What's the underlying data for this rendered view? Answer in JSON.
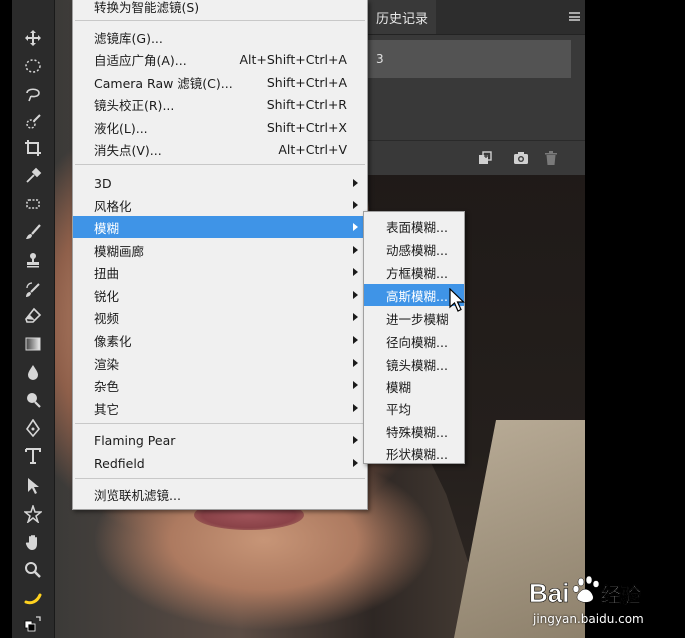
{
  "menu": {
    "items": [
      {
        "label": "转换为智能滤镜(S)",
        "shortcut": ""
      },
      {
        "label": "滤镜库(G)...",
        "shortcut": ""
      },
      {
        "label": "自适应广角(A)...",
        "shortcut": "Alt+Shift+Ctrl+A"
      },
      {
        "label": "Camera Raw 滤镜(C)...",
        "shortcut": "Shift+Ctrl+A"
      },
      {
        "label": "镜头校正(R)...",
        "shortcut": "Shift+Ctrl+R"
      },
      {
        "label": "液化(L)...",
        "shortcut": "Shift+Ctrl+X"
      },
      {
        "label": "消失点(V)...",
        "shortcut": "Alt+Ctrl+V"
      },
      {
        "label": "3D",
        "submenu": true
      },
      {
        "label": "风格化",
        "submenu": true
      },
      {
        "label": "模糊",
        "submenu": true,
        "highlighted": true
      },
      {
        "label": "模糊画廊",
        "submenu": true
      },
      {
        "label": "扭曲",
        "submenu": true
      },
      {
        "label": "锐化",
        "submenu": true
      },
      {
        "label": "视频",
        "submenu": true
      },
      {
        "label": "像素化",
        "submenu": true
      },
      {
        "label": "渲染",
        "submenu": true
      },
      {
        "label": "杂色",
        "submenu": true
      },
      {
        "label": "其它",
        "submenu": true
      },
      {
        "label": "Flaming Pear",
        "submenu": true
      },
      {
        "label": "Redfield",
        "submenu": true
      },
      {
        "label": "浏览联机滤镜...",
        "shortcut": ""
      }
    ]
  },
  "submenu": {
    "items": [
      {
        "label": "表面模糊..."
      },
      {
        "label": "动感模糊..."
      },
      {
        "label": "方框模糊..."
      },
      {
        "label": "高斯模糊...",
        "highlighted": true
      },
      {
        "label": "进一步模糊"
      },
      {
        "label": "径向模糊..."
      },
      {
        "label": "镜头模糊..."
      },
      {
        "label": "模糊"
      },
      {
        "label": "平均"
      },
      {
        "label": "特殊模糊..."
      },
      {
        "label": "形状模糊..."
      }
    ]
  },
  "history_panel": {
    "tab": "历史记录",
    "row": "3"
  },
  "watermark": {
    "brand": "Bai经验",
    "url": "jingyan.baidu.com"
  },
  "colors": {
    "highlight": "#3f94e7",
    "menu_bg": "#f0f0f0",
    "panel_bg": "#393939",
    "toolbar_bg": "#2b2b2b"
  },
  "toolbar": {
    "icons": [
      "move-icon",
      "marquee-icon",
      "lasso-icon",
      "quick-select-icon",
      "crop-icon",
      "eyedropper-icon",
      "healing-icon",
      "brush-icon",
      "stamp-icon",
      "history-brush-icon",
      "eraser-icon",
      "gradient-icon",
      "blur-icon",
      "dodge-icon",
      "pen-icon",
      "type-icon",
      "path-select-icon",
      "shape-icon",
      "hand-icon",
      "zoom-icon",
      "edit-toolbar-icon",
      "swap-colors-icon"
    ]
  }
}
